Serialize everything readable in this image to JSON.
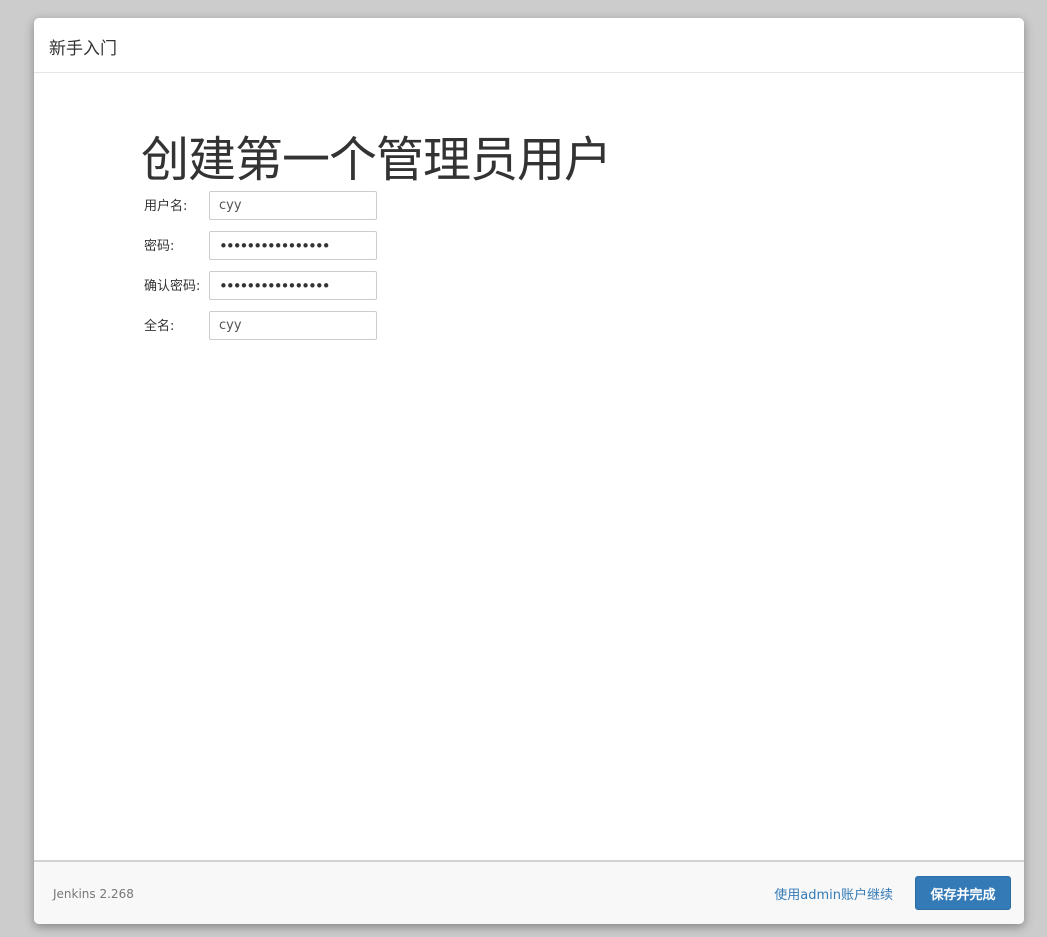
{
  "dialog": {
    "title": "新手入门"
  },
  "main": {
    "heading": "创建第一个管理员用户",
    "form": {
      "username_label": "用户名:",
      "username_value": "cyy",
      "password_label": "密码:",
      "password_value": "••••••••••••••••",
      "confirm_password_label": "确认密码:",
      "confirm_password_value": "••••••••••••••••",
      "fullname_label": "全名:",
      "fullname_value": "cyy"
    }
  },
  "footer": {
    "version": "Jenkins 2.268",
    "continue_as_admin_label": "使用admin账户继续",
    "save_and_finish_label": "保存并完成"
  },
  "colors": {
    "primary": "#337ab7",
    "backdrop": "#cccccc"
  }
}
